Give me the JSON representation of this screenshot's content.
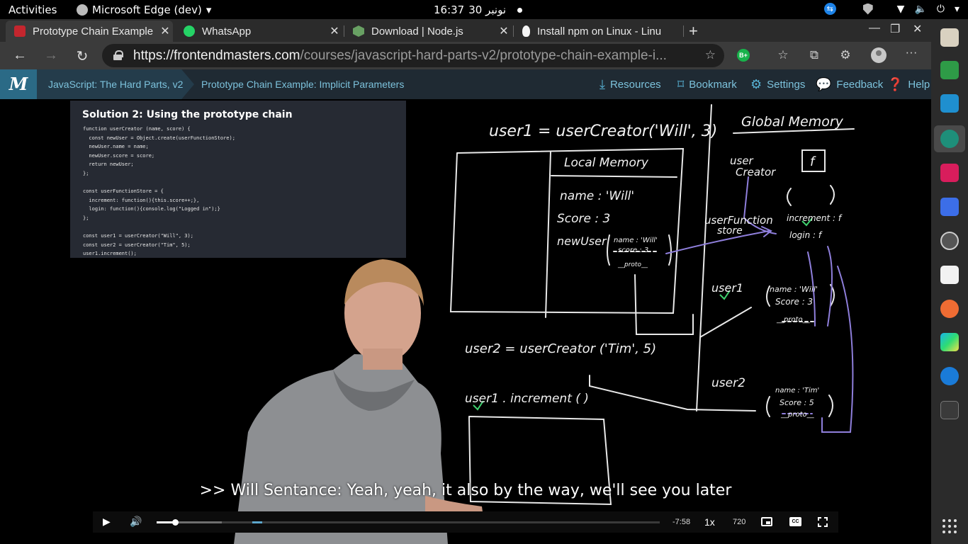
{
  "system": {
    "activities": "Activities",
    "app_name": "Microsoft Edge (dev)",
    "clock_time": "16:37",
    "clock_date": "30 نونبر"
  },
  "tabs": [
    {
      "title": "Prototype Chain Example",
      "favicon_color": "#c4262e",
      "active": true
    },
    {
      "title": "WhatsApp",
      "favicon_color": "#25d366",
      "active": false
    },
    {
      "title": "Download | Node.js",
      "favicon_color": "#68a063",
      "active": false
    },
    {
      "title": "Install npm on Linux - Linu",
      "favicon_color": "#f4f4f4",
      "active": false
    }
  ],
  "address": {
    "host": "https://frontendmasters.com",
    "path": "/courses/javascript-hard-parts-v2/prototype-chain-example-i..."
  },
  "extension": {
    "label": "B+"
  },
  "fm": {
    "logo": "M",
    "course": "JavaScript: The Hard Parts, v2",
    "lesson": "Prototype Chain Example: Implicit Parameters",
    "nav": {
      "resources": "Resources",
      "bookmark": "Bookmark",
      "settings": "Settings",
      "feedback": "Feedback",
      "help": "Help"
    }
  },
  "slide": {
    "title": "Solution 2: Using the prototype chain",
    "code": [
      "function userCreator (name, score) {",
      "  const newUser = Object.create(userFunctionStore);",
      "  newUser.name = name;",
      "  newUser.score = score;",
      "  return newUser;",
      "};",
      "",
      "const userFunctionStore = {",
      "  increment: function(){this.score++;},",
      "  login: function(){console.log(\"Logged in\");}",
      "};",
      "",
      "const user1 = userCreator(\"Will\", 3);",
      "const user2 = userCreator(\"Tim\", 5);",
      "user1.increment();"
    ]
  },
  "whiteboard": {
    "call1": "user1 = userCreator('Will', 3)",
    "local_memory": "Local Memory",
    "global_memory": "Global Memory",
    "name_line": "name : 'Will'",
    "score_line": "Score : 3",
    "newuser_label": "newUser",
    "newuser_name": "name : 'Will'",
    "newuser_score": "score : 3",
    "newuser_proto": "__proto__",
    "user_creator_label_1": "user",
    "user_creator_label_2": "Creator",
    "f_box": "f",
    "store_label_1": "userFunction",
    "store_label_2": "store",
    "increment_entry": "increment : f",
    "login_entry": "login : f",
    "user1_label": "user1",
    "user1_name": "name : 'Will'",
    "user1_score": "Score : 3",
    "user1_proto": "__proto__",
    "call2": "user2 = userCreator ('Tim', 5)",
    "call3": "user1 . increment ( )",
    "user2_label": "user2",
    "user2_name": "name : 'Tim'",
    "user2_score": "Score : 5",
    "user2_proto": "__proto__"
  },
  "caption": ">> Will Sentance: Yeah, yeah, it also by the way, we'll see you later",
  "player": {
    "time_remaining": "-7:58",
    "speed": "1x",
    "quality": "720",
    "cc": "CC",
    "progress": 0.036,
    "buffered": 0.13,
    "buffered_segment_start": 0.19,
    "buffered_segment_end": 0.21
  },
  "dock": {
    "apps": [
      "files-icon",
      "app-green-icon",
      "vscode-icon",
      "edge-dev-icon",
      "intellij-icon",
      "screenshot-icon",
      "clock-icon",
      "document-viewer-icon",
      "postman-icon",
      "webstorm-icon",
      "teamviewer-icon",
      "terminal-icon"
    ]
  }
}
